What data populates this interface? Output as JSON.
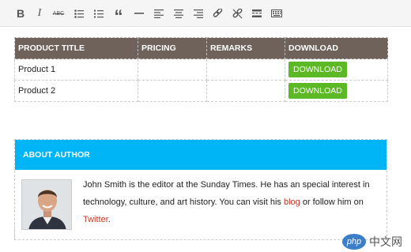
{
  "toolbar": {
    "buttons": [
      {
        "name": "bold-icon",
        "glyph": "B"
      },
      {
        "name": "italic-icon",
        "glyph": "I"
      },
      {
        "name": "strikethrough-icon",
        "glyph": "ABC"
      },
      {
        "name": "bulleted-list-icon"
      },
      {
        "name": "numbered-list-icon"
      },
      {
        "name": "blockquote-icon",
        "glyph": "“"
      },
      {
        "name": "horizontal-line-icon"
      },
      {
        "name": "align-left-icon"
      },
      {
        "name": "align-center-icon"
      },
      {
        "name": "align-right-icon"
      },
      {
        "name": "insert-link-icon"
      },
      {
        "name": "remove-link-icon"
      },
      {
        "name": "read-more-icon"
      },
      {
        "name": "toolbar-toggle-icon"
      }
    ]
  },
  "product_table": {
    "headers": [
      "PRODUCT TITLE",
      "PRICING",
      "REMARKS",
      "DOWNLOAD"
    ],
    "rows": [
      {
        "title": "Product 1",
        "pricing": "",
        "remarks": "",
        "download": "DOWNLOAD"
      },
      {
        "title": "Product 2",
        "pricing": "",
        "remarks": "",
        "download": "DOWNLOAD"
      }
    ],
    "header_color": "#6e625a",
    "button_color": "#5cb824"
  },
  "author_box": {
    "heading": "ABOUT AUTHOR",
    "heading_color": "#00b5f5",
    "text_before": "John Smith is the editor at the Sunday Times. He has an special interest in technology, culture, and art history. You can visit his ",
    "link_blog": "blog",
    "text_middle": " or follow him on ",
    "link_twitter": "Twitter",
    "text_after": ".",
    "link_color": "#c0392b"
  },
  "watermark": {
    "logo": "php",
    "text": "中文网"
  }
}
